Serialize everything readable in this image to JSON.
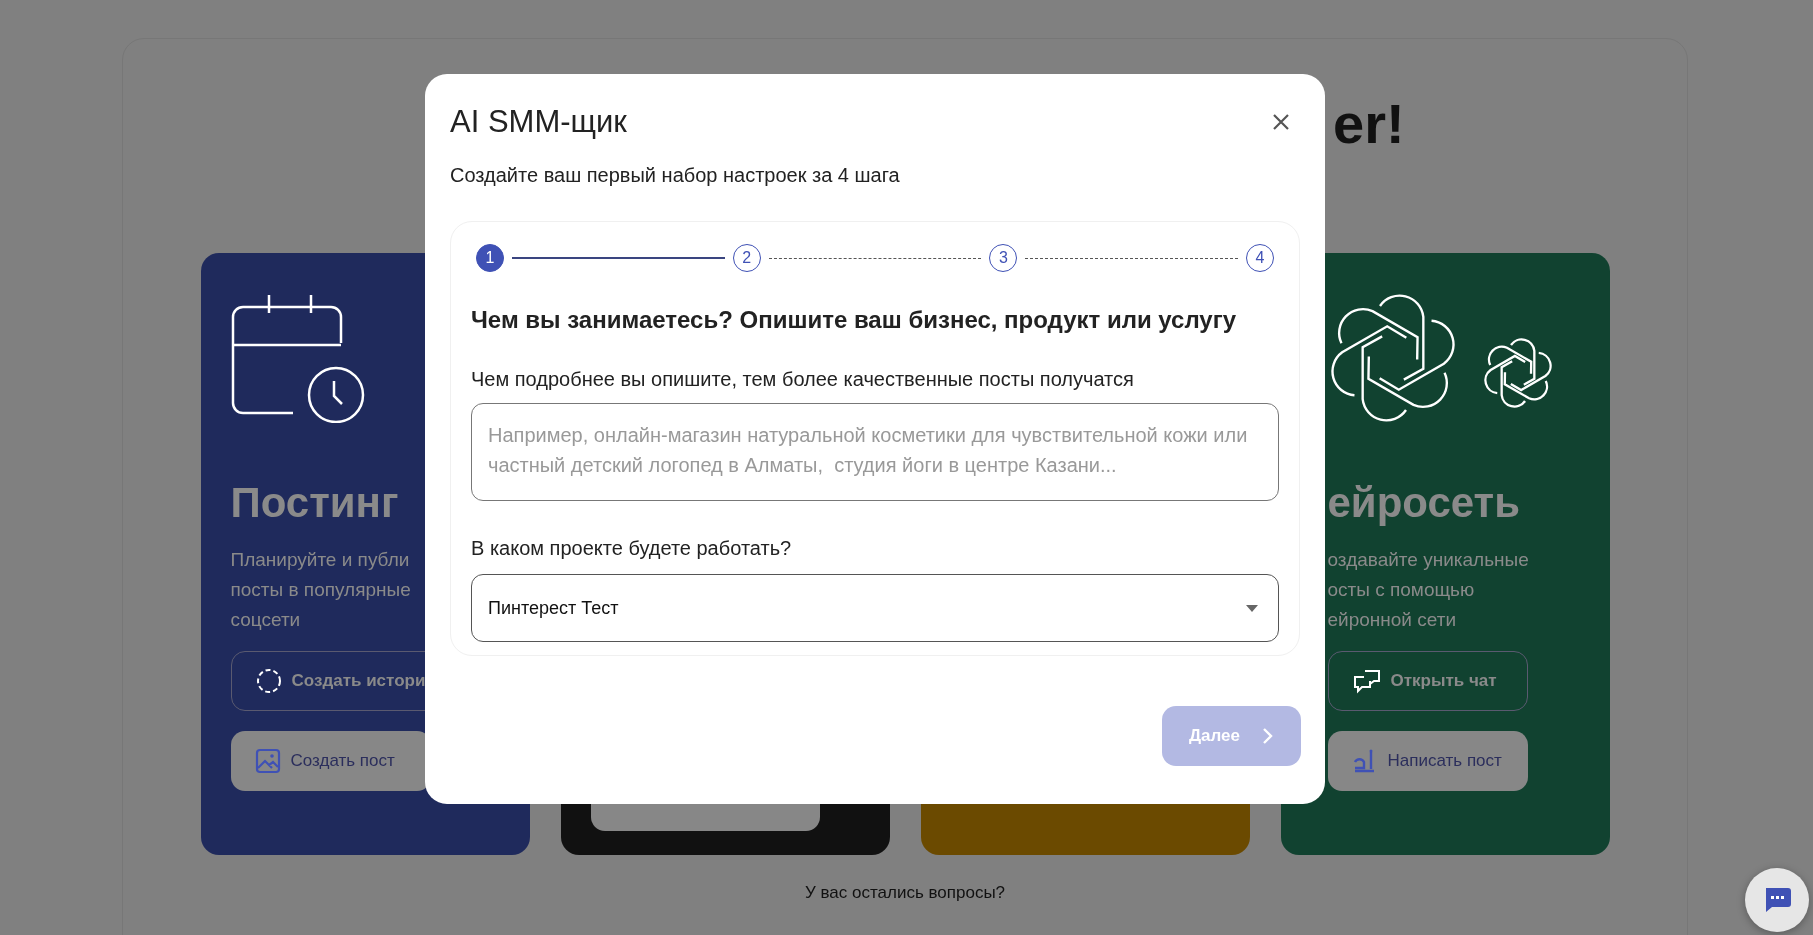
{
  "background": {
    "title_fragment": "er!",
    "cards": [
      {
        "kind": "calendar",
        "color": "#1f2a5c",
        "title": "Постинг",
        "description": [
          "Планируйте и публи",
          "посты в популярные",
          "соцсети"
        ],
        "buttons": [
          {
            "kind": "outline",
            "label": "Создать истори"
          },
          {
            "kind": "filled",
            "label": "Создать пост"
          }
        ]
      },
      {
        "kind": "covered",
        "color": "#111111",
        "button_edge": true
      },
      {
        "kind": "covered",
        "color": "#6b4a00"
      },
      {
        "kind": "knot",
        "color": "#114230",
        "title": "ейросеть",
        "description": [
          "оздавайте уникальные",
          "осты с помощью",
          "ейронной сети"
        ],
        "buttons": [
          {
            "kind": "outline",
            "label": "Открыть чат"
          },
          {
            "kind": "filled",
            "label": "Написать пост"
          }
        ]
      }
    ],
    "footer": "У вас остались вопросы?"
  },
  "modal": {
    "title": "AI SMM-щик",
    "subtitle": "Создайте ваш первый набор настроек за 4 шага",
    "steps": [
      {
        "label": "1",
        "selected": true
      },
      {
        "label": "2",
        "selected": false
      },
      {
        "label": "3",
        "selected": false
      },
      {
        "label": "4",
        "selected": false
      }
    ],
    "question": "Чем вы занимаетесь? Опишите ваш бизнес, продукт или услугу",
    "hint": "Чем подробнее вы опишите, тем более качественные посты получатся",
    "description_field": {
      "placeholder": "Например, онлайн-магазин натуральной косметики для чувствительной кожи или частный детский логопед в Алматы,  студия йоги в центре Казани..."
    },
    "project_label": "В каком проекте будете работать?",
    "project_select": {
      "value": "Пинтерест Тест"
    },
    "next_button": {
      "label": "Далее",
      "disabled": true
    }
  }
}
